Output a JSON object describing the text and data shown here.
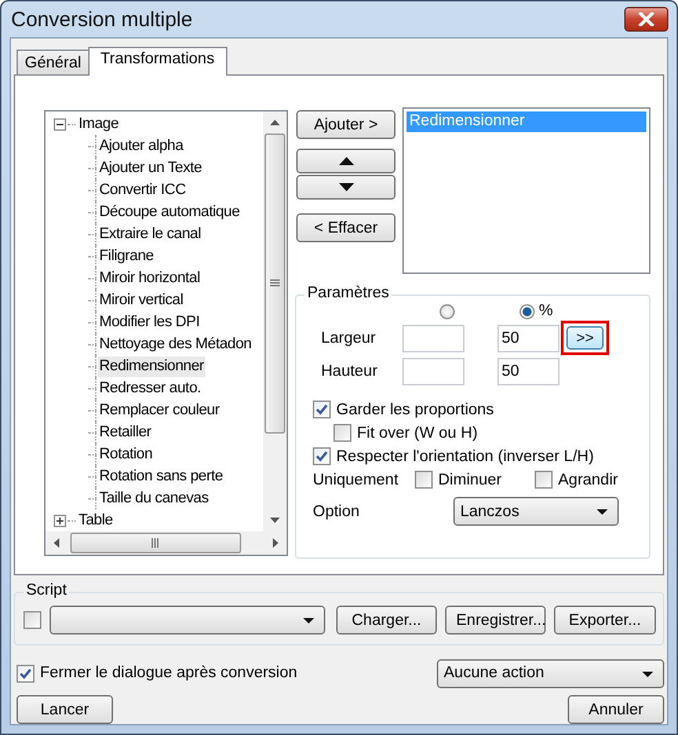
{
  "window": {
    "title": "Conversion multiple"
  },
  "tabs": [
    {
      "label": "Général",
      "selected": false
    },
    {
      "label": "Transformations",
      "selected": true
    }
  ],
  "tree": {
    "nodes": [
      {
        "label": "Image",
        "expanded": true,
        "selected": false,
        "children": [
          {
            "label": "Ajouter alpha",
            "selected": false
          },
          {
            "label": "Ajouter un Texte",
            "selected": false
          },
          {
            "label": "Convertir ICC",
            "selected": false
          },
          {
            "label": "Découpe automatique",
            "selected": false
          },
          {
            "label": "Extraire le canal",
            "selected": false
          },
          {
            "label": "Filigrane",
            "selected": false
          },
          {
            "label": "Miroir horizontal",
            "selected": false
          },
          {
            "label": "Miroir vertical",
            "selected": false
          },
          {
            "label": "Modifier les DPI",
            "selected": false
          },
          {
            "label": "Nettoyage des Métadon",
            "selected": false
          },
          {
            "label": "Redimensionner",
            "selected": true
          },
          {
            "label": "Redresser auto.",
            "selected": false
          },
          {
            "label": "Remplacer couleur",
            "selected": false
          },
          {
            "label": "Retailler",
            "selected": false
          },
          {
            "label": "Rotation",
            "selected": false
          },
          {
            "label": "Rotation sans perte",
            "selected": false
          },
          {
            "label": "Taille du canevas",
            "selected": false
          }
        ]
      },
      {
        "label": "Table",
        "expanded": false,
        "selected": false
      }
    ]
  },
  "add_button": "Ajouter >",
  "remove_button": "< Effacer",
  "selected_list": [
    {
      "label": "Redimensionner",
      "selected": true
    }
  ],
  "parameters": {
    "title": "Paramètres",
    "units": [
      {
        "selected": false
      },
      {
        "label": "%",
        "selected": true
      }
    ],
    "sizes": [
      {
        "label": "Largeur",
        "value": "50"
      },
      {
        "label": "Hauteur",
        "value": "50"
      }
    ],
    "swap_button": {
      "label": ">>",
      "highlighted": true
    },
    "keep_proportions": {
      "label": "Garder les proportions",
      "checked": true
    },
    "fit_over": {
      "label": "Fit over (W ou H)",
      "checked": false
    },
    "respect_orientation": {
      "label": "Respecter l'orientation (inverser L/H)",
      "checked": true
    },
    "only": {
      "label": "Uniquement",
      "options": [
        {
          "label": "Diminuer",
          "checked": false
        },
        {
          "label": "Agrandir",
          "checked": false
        }
      ]
    },
    "option": {
      "label": "Option",
      "value": "Lanczos"
    }
  },
  "script": {
    "title": "Script",
    "checked": false,
    "buttons": [
      "Charger...",
      "Enregistrer...",
      "Exporter..."
    ]
  },
  "close_after": {
    "label": "Fermer le dialogue après conversion",
    "checked": true
  },
  "after_action": "Aucune action",
  "run_button": "Lancer",
  "cancel_button": "Annuler"
}
